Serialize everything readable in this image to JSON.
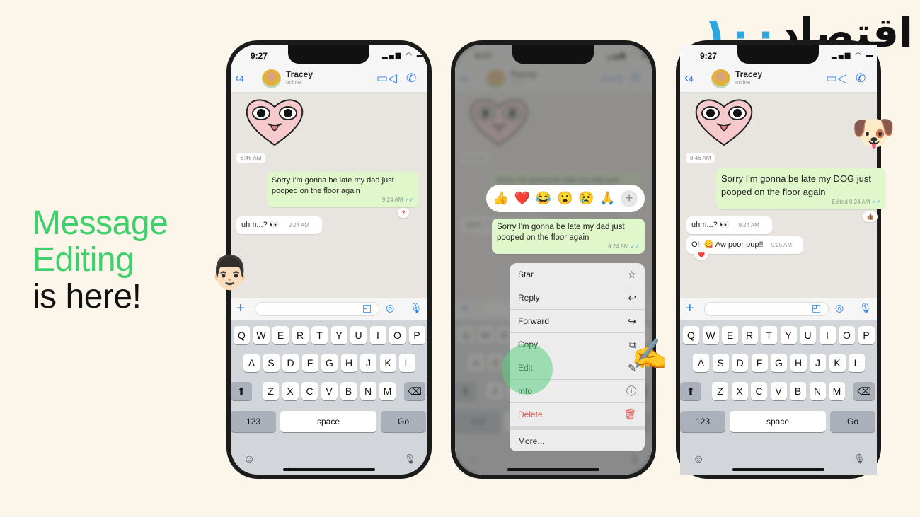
{
  "headline": {
    "line1": "Message",
    "line2": "Editing",
    "line3": "is here!",
    "accent_color": "#3fd06d"
  },
  "logo": {
    "text": "اقتصاد",
    "number": "۱۰۰"
  },
  "status": {
    "time": "9:27",
    "icons": "signal-wifi-battery"
  },
  "chat_header": {
    "back_count": "4",
    "name": "Tracey",
    "status": "online"
  },
  "chat": {
    "date_pill": "8:46 AM",
    "outgoing_original": "Sorry I'm gonna be late my dad just pooped on the floor again",
    "outgoing_edited": "Sorry I'm gonna be late my DOG just pooped on the floor again",
    "outgoing_time": "9:24 AM",
    "outgoing_time_edited": "Edited 9:24 AM",
    "reaction_question": "?",
    "reaction_thumb": "👍🏽",
    "incoming_1": "uhm...? 👀",
    "incoming_1_time": "9:24 AM",
    "incoming_2": "Oh 😋 Aw poor pup!!",
    "incoming_2_time": "9:25 AM",
    "incoming_2_reaction": "❤️"
  },
  "reactions": [
    "👍",
    "❤️",
    "😂",
    "😮",
    "😢",
    "🙏"
  ],
  "reaction_more": "+",
  "context_menu": [
    {
      "label": "Star",
      "icon": "☆"
    },
    {
      "label": "Reply",
      "icon": "↩"
    },
    {
      "label": "Forward",
      "icon": "↪"
    },
    {
      "label": "Copy",
      "icon": "⧉"
    },
    {
      "label": "Edit",
      "icon": "✎"
    },
    {
      "label": "Info",
      "icon": "ⓘ"
    },
    {
      "label": "Delete",
      "icon": "🗑"
    },
    {
      "label": "More..."
    }
  ],
  "keyboard": {
    "rows": [
      [
        "Q",
        "W",
        "E",
        "R",
        "T",
        "Y",
        "U",
        "I",
        "O",
        "P"
      ],
      [
        "A",
        "S",
        "D",
        "F",
        "G",
        "H",
        "J",
        "K",
        "L"
      ],
      [
        "Z",
        "X",
        "C",
        "V",
        "B",
        "N",
        "M"
      ]
    ],
    "shift": "⬆",
    "backspace": "⌫",
    "numbers": "123",
    "space": "space",
    "go": "Go",
    "emoji_icon": "☺",
    "mic_icon": "🎙"
  },
  "decor": {
    "man_emoji": "👨🏻",
    "dog_emoji": "🐶",
    "writing_hand_emoji": "✍️"
  }
}
